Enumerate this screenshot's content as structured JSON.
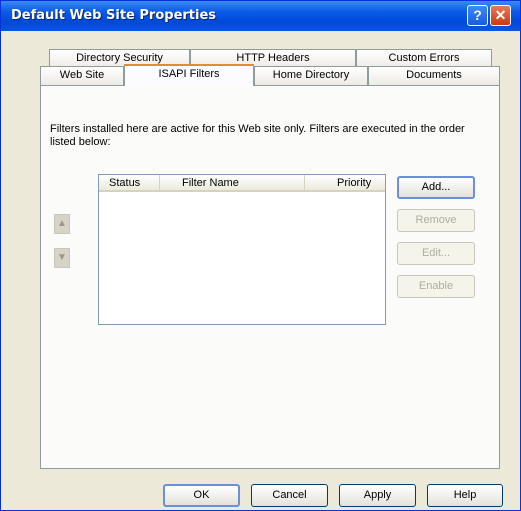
{
  "window": {
    "title": "Default Web Site Properties"
  },
  "title_buttons": {
    "help": "?",
    "close": "✕"
  },
  "tabs": {
    "row1": [
      {
        "label": "Directory Security"
      },
      {
        "label": "HTTP Headers"
      },
      {
        "label": "Custom Errors"
      }
    ],
    "row2": [
      {
        "label": "Web Site"
      },
      {
        "label": "ISAPI Filters",
        "active": true
      },
      {
        "label": "Home Directory"
      },
      {
        "label": "Documents"
      }
    ]
  },
  "description": "Filters installed here are active for this Web site only. Filters are executed in the order listed below:",
  "filters_list": {
    "columns": [
      "Status",
      "Filter Name",
      "Priority"
    ],
    "rows": []
  },
  "side_buttons": {
    "add": "Add...",
    "remove": "Remove",
    "edit": "Edit...",
    "enable": "Enable"
  },
  "order_buttons": {
    "up": "▲",
    "down": "▼"
  },
  "dialog_buttons": {
    "ok": "OK",
    "cancel": "Cancel",
    "apply": "Apply",
    "help": "Help"
  }
}
